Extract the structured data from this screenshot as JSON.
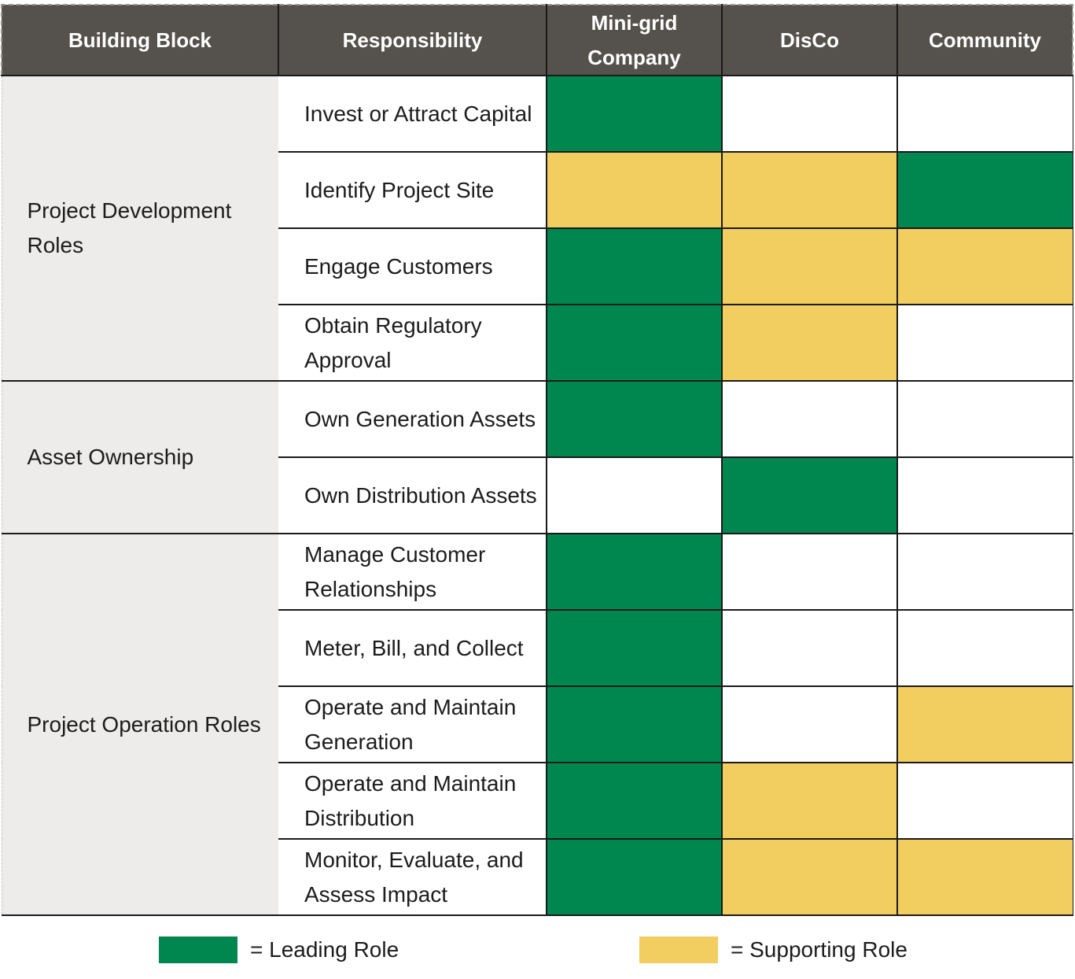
{
  "table": {
    "headers": [
      "Building Block",
      "Responsibility",
      "Mini-grid Company",
      "DisCo",
      "Community"
    ],
    "groups": [
      {
        "label": "Project Development Roles",
        "rows": [
          {
            "responsibility": "Invest or Attract Capital",
            "roles": [
              "leading",
              "none",
              "none"
            ]
          },
          {
            "responsibility": "Identify Project Site",
            "roles": [
              "supporting",
              "supporting",
              "leading"
            ]
          },
          {
            "responsibility": "Engage Customers",
            "roles": [
              "leading",
              "supporting",
              "supporting"
            ]
          },
          {
            "responsibility": "Obtain Regulatory Approval",
            "roles": [
              "leading",
              "supporting",
              "none"
            ]
          }
        ]
      },
      {
        "label": "Asset Ownership",
        "rows": [
          {
            "responsibility": "Own Generation Assets",
            "roles": [
              "leading",
              "none",
              "none"
            ]
          },
          {
            "responsibility": "Own Distribution Assets",
            "roles": [
              "none",
              "leading",
              "none"
            ]
          }
        ]
      },
      {
        "label": "Project Operation Roles",
        "rows": [
          {
            "responsibility": "Manage Customer Relationships",
            "roles": [
              "leading",
              "none",
              "none"
            ]
          },
          {
            "responsibility": "Meter, Bill, and Collect",
            "roles": [
              "leading",
              "none",
              "none"
            ]
          },
          {
            "responsibility": "Operate and Maintain Generation",
            "roles": [
              "leading",
              "none",
              "supporting"
            ]
          },
          {
            "responsibility": "Operate and Maintain Distribution",
            "roles": [
              "leading",
              "supporting",
              "none"
            ]
          },
          {
            "responsibility": "Monitor, Evaluate, and Assess Impact",
            "roles": [
              "leading",
              "supporting",
              "supporting"
            ]
          }
        ]
      }
    ]
  },
  "legend": {
    "leading": {
      "label": "= Leading Role",
      "color": "#00874f"
    },
    "supporting": {
      "label": "= Supporting Role",
      "color": "#f2cd5f"
    }
  },
  "colors": {
    "header_bg": "#55514c",
    "block_bg": "#edecea",
    "leading": "#00874f",
    "supporting": "#f2cd5f"
  }
}
